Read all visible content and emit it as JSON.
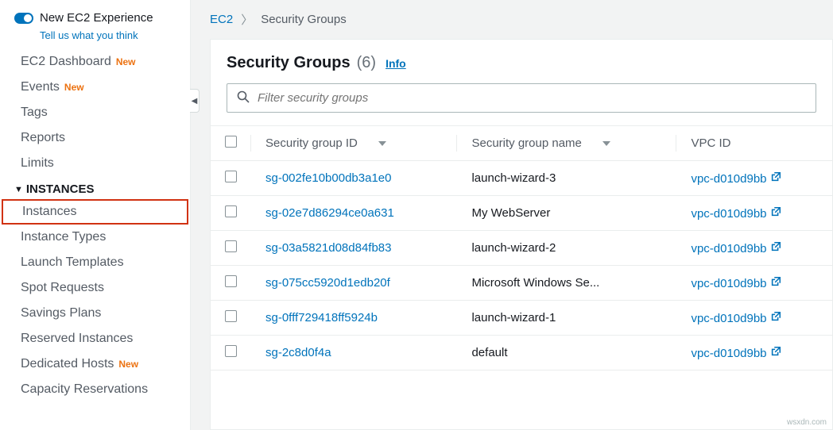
{
  "header": {
    "toggle_label": "New EC2 Experience",
    "feedback": "Tell us what you think"
  },
  "nav": {
    "top_items": [
      {
        "label": "EC2 Dashboard",
        "badge": "New"
      },
      {
        "label": "Events",
        "badge": "New"
      },
      {
        "label": "Tags"
      },
      {
        "label": "Reports"
      },
      {
        "label": "Limits"
      }
    ],
    "section": "INSTANCES",
    "instance_items": [
      {
        "label": "Instances",
        "highlighted": true
      },
      {
        "label": "Instance Types"
      },
      {
        "label": "Launch Templates"
      },
      {
        "label": "Spot Requests"
      },
      {
        "label": "Savings Plans"
      },
      {
        "label": "Reserved Instances"
      },
      {
        "label": "Dedicated Hosts",
        "badge": "New"
      },
      {
        "label": "Capacity Reservations"
      }
    ]
  },
  "breadcrumb": {
    "root": "EC2",
    "current": "Security Groups"
  },
  "panel": {
    "title": "Security Groups",
    "count": "(6)",
    "info": "Info",
    "filter_placeholder": "Filter security groups"
  },
  "table": {
    "columns": [
      "Security group ID",
      "Security group name",
      "VPC ID"
    ],
    "rows": [
      {
        "id": "sg-002fe10b00db3a1e0",
        "name": "launch-wizard-3",
        "vpc": "vpc-d010d9bb"
      },
      {
        "id": "sg-02e7d86294ce0a631",
        "name": "My WebServer",
        "vpc": "vpc-d010d9bb"
      },
      {
        "id": "sg-03a5821d08d84fb83",
        "name": "launch-wizard-2",
        "vpc": "vpc-d010d9bb"
      },
      {
        "id": "sg-075cc5920d1edb20f",
        "name": "Microsoft Windows Se...",
        "vpc": "vpc-d010d9bb"
      },
      {
        "id": "sg-0fff729418ff5924b",
        "name": "launch-wizard-1",
        "vpc": "vpc-d010d9bb"
      },
      {
        "id": "sg-2c8d0f4a",
        "name": "default",
        "vpc": "vpc-d010d9bb"
      }
    ]
  },
  "watermark": "wsxdn.com"
}
